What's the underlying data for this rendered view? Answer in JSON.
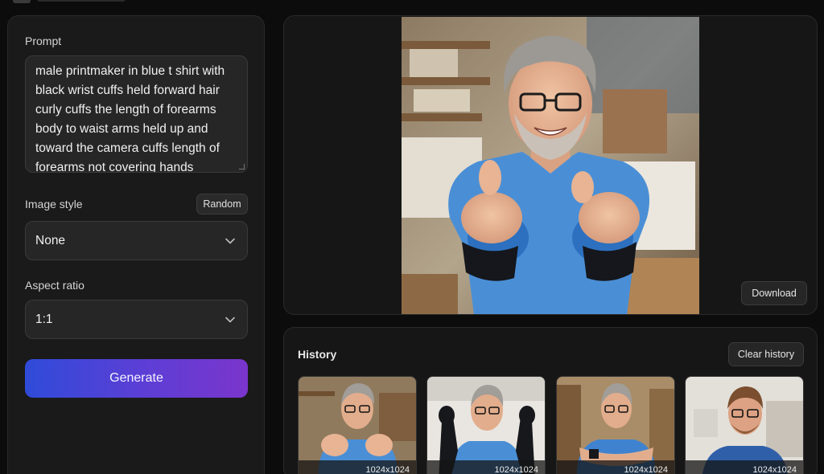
{
  "form": {
    "prompt_label": "Prompt",
    "prompt_text": "male printmaker in blue t shirt with black wrist cuffs held forward hair curly cuffs the length of forearms body to waist arms held up and toward the camera cuffs length of forearms not covering hands",
    "style_label": "Image style",
    "random_label": "Random",
    "style_value": "None",
    "aspect_label": "Aspect ratio",
    "aspect_value": "1:1",
    "generate_label": "Generate"
  },
  "preview": {
    "download_label": "Download"
  },
  "history": {
    "title": "History",
    "clear_label": "Clear history",
    "items": [
      {
        "dimensions": "1024x1024"
      },
      {
        "dimensions": "1024x1024"
      },
      {
        "dimensions": "1024x1024"
      },
      {
        "dimensions": "1024x1024"
      }
    ]
  },
  "colors": {
    "accent_start": "#2f4bd8",
    "accent_end": "#7b35cc",
    "panel_bg": "#1a1a1a",
    "shirt_blue": "#4a8fd6"
  }
}
